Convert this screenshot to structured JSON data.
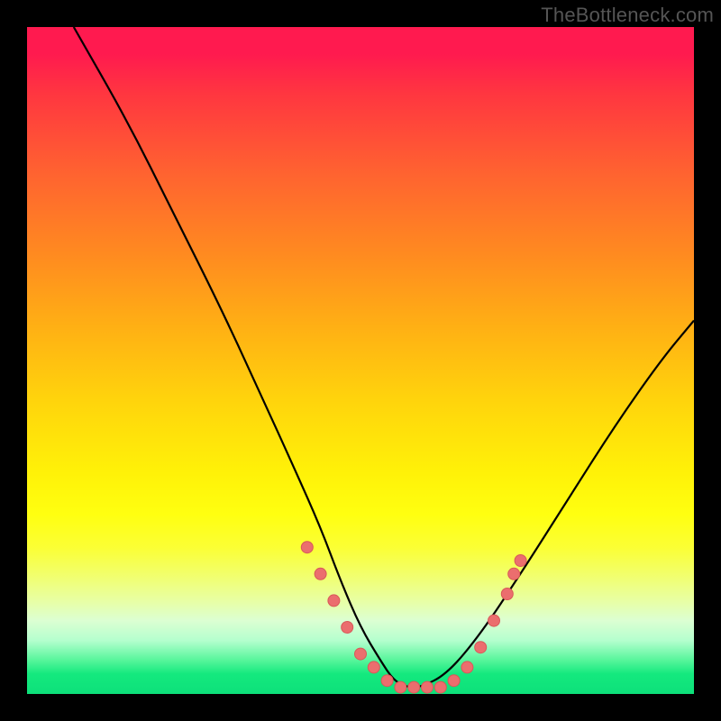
{
  "watermark": "TheBottleneck.com",
  "chart_data": {
    "type": "line",
    "title": "",
    "xlabel": "",
    "ylabel": "",
    "xlim": [
      0,
      100
    ],
    "ylim": [
      0,
      100
    ],
    "series": [
      {
        "name": "curve",
        "x": [
          7,
          15,
          22,
          29,
          35,
          40,
          44,
          47,
          50,
          53,
          55,
          57,
          59,
          63,
          68,
          74,
          81,
          88,
          95,
          100
        ],
        "y": [
          100,
          86,
          72,
          58,
          45,
          34,
          25,
          17,
          10,
          5,
          2,
          1,
          1,
          3,
          9,
          18,
          29,
          40,
          50,
          56
        ]
      }
    ],
    "markers": {
      "name": "dots",
      "x": [
        42,
        44,
        46,
        48,
        50,
        52,
        54,
        56,
        58,
        60,
        62,
        64,
        66,
        68,
        70,
        72,
        73,
        74
      ],
      "y": [
        22,
        18,
        14,
        10,
        6,
        4,
        2,
        1,
        1,
        1,
        1,
        2,
        4,
        7,
        11,
        15,
        18,
        20
      ]
    },
    "background_gradient": {
      "orientation": "vertical",
      "stops": [
        {
          "pos": 0.0,
          "color": "#ff1a4f"
        },
        {
          "pos": 0.35,
          "color": "#ff8a20"
        },
        {
          "pos": 0.7,
          "color": "#ffff10"
        },
        {
          "pos": 1.0,
          "color": "#0de07a"
        }
      ]
    }
  }
}
